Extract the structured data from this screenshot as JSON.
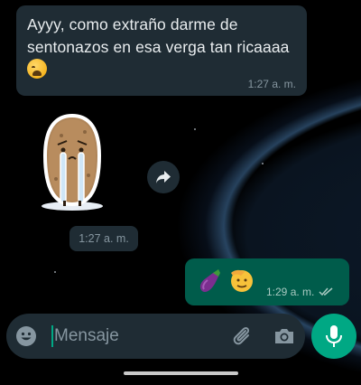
{
  "messages": {
    "incoming_text": {
      "text": "Ayyy, como extraño darme de sentonazos en esa verga tan ricaaaa",
      "emoji": "weary-face-emoji",
      "time": "1:27 a. m."
    },
    "incoming_sticker": {
      "sticker": "crying-potato-sticker",
      "time": "1:27 a. m."
    },
    "outgoing": {
      "emojis": [
        "eggplant-emoji",
        "saluting-face-emoji"
      ],
      "time": "1:29 a. m.",
      "status_icon": "double-check-read-icon"
    }
  },
  "composer": {
    "placeholder": "Mensaje",
    "emoji_icon": "emoji-icon",
    "attach_icon": "paperclip-icon",
    "camera_icon": "camera-icon",
    "send_icon": "microphone-icon"
  },
  "colors": {
    "incoming_bubble": "#1f2c34",
    "outgoing_bubble": "#005c4b",
    "accent": "#00a884",
    "meta_text": "#8696a0"
  }
}
